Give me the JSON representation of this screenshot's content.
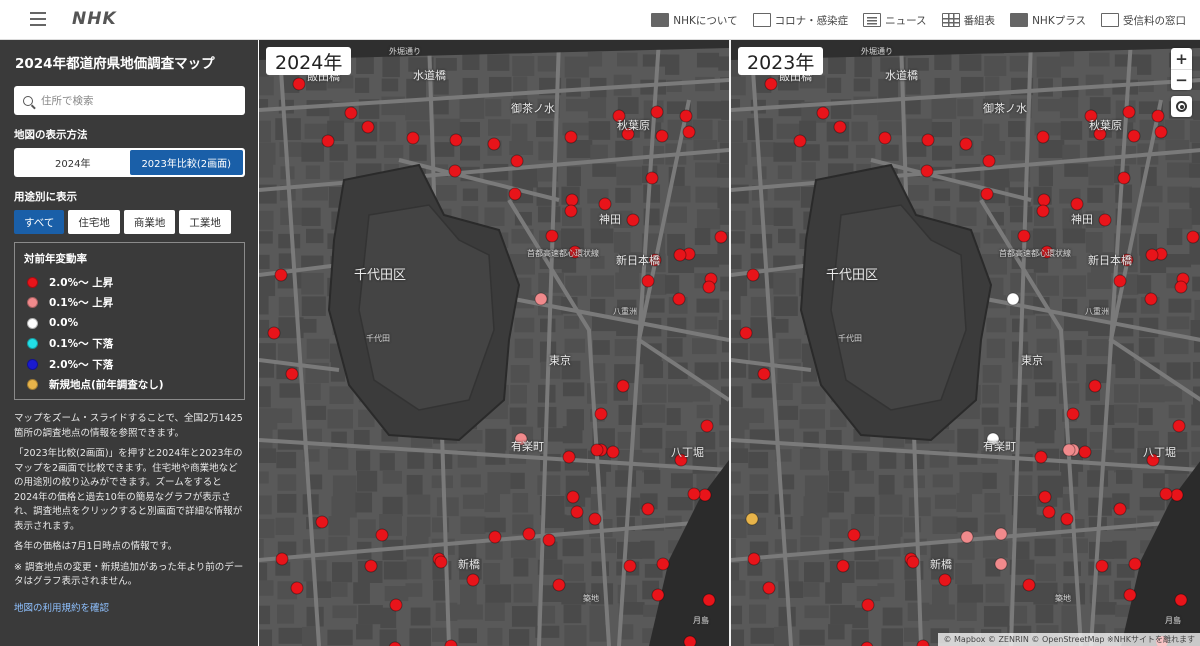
{
  "header": {
    "logo": "NHK",
    "nav": [
      {
        "label": "NHKについて",
        "icon": "nhk-logo-icon"
      },
      {
        "label": "コロナ・感染症",
        "icon": "corona-icon"
      },
      {
        "label": "ニュース",
        "icon": "news-icon"
      },
      {
        "label": "番組表",
        "icon": "schedule-grid-icon"
      },
      {
        "label": "NHKプラス",
        "icon": "nhk-plus-icon"
      },
      {
        "label": "受信料の窓口",
        "icon": "fee-window-icon"
      }
    ]
  },
  "sidebar": {
    "title": "2024年都道府県地価調査マップ",
    "search_placeholder": "住所で検索",
    "display_mode_label": "地図の表示方法",
    "display_modes": [
      {
        "label": "2024年",
        "active": false
      },
      {
        "label": "2023年比較(2画面)",
        "active": true
      }
    ],
    "use_label": "用途別に表示",
    "uses": [
      {
        "label": "すべて",
        "active": true
      },
      {
        "label": "住宅地",
        "active": false
      },
      {
        "label": "商業地",
        "active": false
      },
      {
        "label": "工業地",
        "active": false
      }
    ],
    "legend": {
      "title": "対前年変動率",
      "items": [
        {
          "label": "2.0%～ 上昇",
          "color": "#e8141a"
        },
        {
          "label": "0.1%～ 上昇",
          "color": "#f08a8c"
        },
        {
          "label": "0.0%",
          "color": "#ffffff"
        },
        {
          "label": "0.1%～ 下落",
          "color": "#22e0e8"
        },
        {
          "label": "2.0%～ 下落",
          "color": "#1a1ad0"
        },
        {
          "label": "新規地点(前年調査なし)",
          "color": "#e8b44a"
        }
      ]
    },
    "description": [
      "マップをズーム・スライドすることで、全国2万1425箇所の調査地点の情報を参照できます。",
      "「2023年比較(2画面)」を押すと2024年と2023年のマップを2画面で比較できます。住宅地や商業地などの用途別の絞り込みができます。ズームをすると2024年の価格と過去10年の簡易なグラフが表示され、調査地点をクリックすると別画面で詳細な情報が表示されます。",
      "各年の価格は7月1日時点の情報です。",
      "※ 調査地点の変更・新規追加があった年より前のデータはグラフ表示されません。"
    ],
    "terms_link": "地図の利用規約を確認"
  },
  "maps": {
    "left_year": "2024年",
    "right_year": "2023年",
    "zoom_in": "+",
    "zoom_out": "−",
    "attribution": "© Mapbox © ZENRIN © OpenStreetMap ※NHKサイトを離れます",
    "labels": [
      {
        "id": "iidabashi",
        "text": "飯田橋"
      },
      {
        "id": "suidobashi",
        "text": "水道橋"
      },
      {
        "id": "ochanomizu",
        "text": "御茶ノ水"
      },
      {
        "id": "akihabara",
        "text": "秋葉原"
      },
      {
        "id": "kanda",
        "text": "神田"
      },
      {
        "id": "chiyoda-ku",
        "text": "千代田区"
      },
      {
        "id": "shin-nihombashi",
        "text": "新日本橋"
      },
      {
        "id": "chiyoda",
        "text": "千代田"
      },
      {
        "id": "tokyo",
        "text": "東京"
      },
      {
        "id": "yurakucho",
        "text": "有楽町"
      },
      {
        "id": "hatchobori",
        "text": "八丁堀"
      },
      {
        "id": "shimbashi",
        "text": "新橋"
      },
      {
        "id": "tsukiji",
        "text": "築地"
      },
      {
        "id": "tsukishima",
        "text": "月島"
      },
      {
        "id": "sotobori",
        "text": "外堀通り"
      },
      {
        "id": "shutoko",
        "text": "首都高速都心環状線"
      },
      {
        "id": "yaesu",
        "text": "八重洲"
      }
    ]
  }
}
